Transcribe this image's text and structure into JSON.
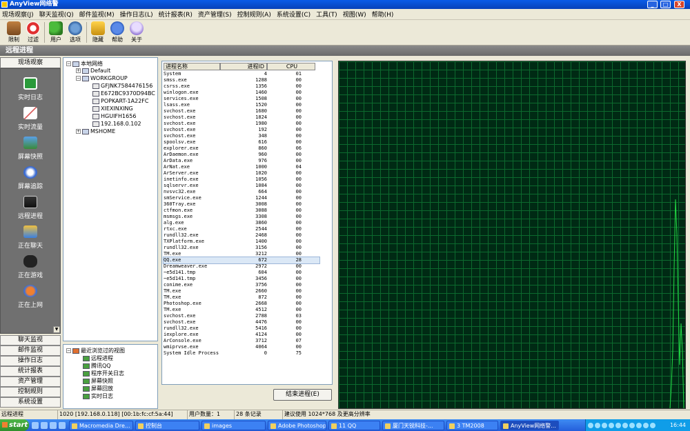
{
  "window": {
    "title": "AnyView网络警",
    "min": "_",
    "max": "□",
    "close": "X"
  },
  "menu": [
    "现场观察(J)",
    "聊天监视(Q)",
    "邮件监视(M)",
    "操作日志(L)",
    "统计报表(R)",
    "资产管理(S)",
    "控制规则(A)",
    "系统设置(C)",
    "工具(T)",
    "视图(W)",
    "帮助(H)"
  ],
  "toolbar": [
    {
      "label": "限制",
      "icon": "house-icon"
    },
    {
      "label": "过滤",
      "icon": "lifebuoy-icon"
    },
    {
      "label": "用户",
      "icon": "users-icon"
    },
    {
      "label": "选项",
      "icon": "gears-icon"
    },
    {
      "label": "隐藏",
      "icon": "lock-icon"
    },
    {
      "label": "帮助",
      "icon": "help-icon"
    },
    {
      "label": "关于",
      "icon": "bulb-icon"
    }
  ],
  "section_title": "远程进程",
  "leftnav": {
    "header": "现场观察",
    "items": [
      {
        "label": "实时日志",
        "icon": "log-icon"
      },
      {
        "label": "实时流量",
        "icon": "traffic-icon"
      },
      {
        "label": "屏幕快照",
        "icon": "screenshot-icon"
      },
      {
        "label": "屏幕追踪",
        "icon": "screen-track-icon"
      },
      {
        "label": "远程进程",
        "icon": "remote-process-icon"
      },
      {
        "label": "正在聊天",
        "icon": "chat-icon"
      },
      {
        "label": "正在游戏",
        "icon": "gamepad-icon"
      },
      {
        "label": "正在上网",
        "icon": "browsing-icon"
      }
    ],
    "buttons": [
      "聊天监视",
      "邮件监视",
      "操作日志",
      "统计报表",
      "资产管理",
      "控制规则",
      "系统设置"
    ]
  },
  "tree": {
    "root": "本地网络",
    "default": "Default",
    "group": "WORKGROUP",
    "hosts": [
      "GFJNK7584476156",
      "E672BC9370D94BC",
      "POPKART-1A22FC",
      "XIEXINXING",
      "HGUIFH1656",
      "192.168.0.102"
    ],
    "mshome": "MSHOME"
  },
  "recent": {
    "root": "最近浏览过的视图",
    "items": [
      "远程进程",
      "腾讯QQ",
      "程序开关日志",
      "屏幕快照",
      "屏幕回放",
      "实时日志"
    ]
  },
  "process_table": {
    "headers": [
      "进程名称",
      "进程ID",
      "CPU"
    ],
    "selected_index": 31,
    "rows": [
      [
        "System",
        "4",
        "01"
      ],
      [
        "smss.exe",
        "1288",
        "00"
      ],
      [
        "csrss.exe",
        "1356",
        "00"
      ],
      [
        "winlogon.exe",
        "1460",
        "00"
      ],
      [
        "services.exe",
        "1508",
        "00"
      ],
      [
        "lsass.exe",
        "1520",
        "00"
      ],
      [
        "svchost.exe",
        "1680",
        "00"
      ],
      [
        "svchost.exe",
        "1824",
        "00"
      ],
      [
        "svchost.exe",
        "1980",
        "00"
      ],
      [
        "svchost.exe",
        "192",
        "00"
      ],
      [
        "svchost.exe",
        "348",
        "00"
      ],
      [
        "spoolsv.exe",
        "616",
        "00"
      ],
      [
        "explorer.exe",
        "860",
        "06"
      ],
      [
        "ArDaemon.exe",
        "960",
        "00"
      ],
      [
        "ArData.exe",
        "976",
        "00"
      ],
      [
        "ArNat.exe",
        "1000",
        "04"
      ],
      [
        "ArServer.exe",
        "1020",
        "00"
      ],
      [
        "inetinfo.exe",
        "1056",
        "00"
      ],
      [
        "sqlservr.exe",
        "1084",
        "00"
      ],
      [
        "nvsvc32.exe",
        "664",
        "00"
      ],
      [
        "smService.exe",
        "1244",
        "00"
      ],
      [
        "360Tray.exe",
        "3008",
        "00"
      ],
      [
        "ctfmon.exe",
        "3088",
        "00"
      ],
      [
        "msmsgs.exe",
        "3308",
        "00"
      ],
      [
        "alg.exe",
        "3860",
        "00"
      ],
      [
        "rtxc.exe",
        "2544",
        "00"
      ],
      [
        "rundll32.exe",
        "2468",
        "00"
      ],
      [
        "TXPlatform.exe",
        "1400",
        "00"
      ],
      [
        "rundll32.exe",
        "3156",
        "00"
      ],
      [
        "TM.exe",
        "3212",
        "00"
      ],
      [
        "QQ.exe",
        "672",
        "28"
      ],
      [
        "Dreamweaver.exe",
        "2972",
        "00"
      ],
      [
        "~e5d141.tmp",
        "604",
        "00"
      ],
      [
        "~e5d141.tmp",
        "3456",
        "00"
      ],
      [
        "conime.exe",
        "3756",
        "00"
      ],
      [
        "TM.exe",
        "2660",
        "00"
      ],
      [
        "TM.exe",
        "872",
        "00"
      ],
      [
        "Photoshop.exe",
        "2668",
        "00"
      ],
      [
        "TM.exe",
        "4512",
        "00"
      ],
      [
        "svchost.exe",
        "2788",
        "03"
      ],
      [
        "svchost.exe",
        "4476",
        "00"
      ],
      [
        "rundll32.exe",
        "5416",
        "00"
      ],
      [
        "iexplore.exe",
        "4124",
        "00"
      ],
      [
        "ArConsole.exe",
        "3712",
        "07"
      ],
      [
        "wmiprvse.exe",
        "4064",
        "00"
      ],
      [
        "System Idle Process",
        "0",
        "75"
      ]
    ]
  },
  "end_process_button": "结束进程(E)",
  "statusbar": [
    "远程进程",
    "1020 [192.168.0.118] [00:1b:fc:cf:5a:44]",
    "用户数量：1",
    "28 条记录",
    "建议使用 1024*768 及更高分辨率"
  ],
  "taskbar": {
    "start": "start",
    "tasks": [
      "Macromedia Dre...",
      "控制台",
      "images",
      "Adobe Photoshop",
      "11 QQ",
      "厦门天锐科技-...",
      "3 TM2008",
      "AnyView网络警..."
    ],
    "active_task": 7,
    "clock": "16:44"
  },
  "colors": {
    "title": "#0a5ce8",
    "graph_bg": "#002a14",
    "grid": "#0c6a2e",
    "graph_line": "#22dd44",
    "nav_bg": "#707070"
  }
}
